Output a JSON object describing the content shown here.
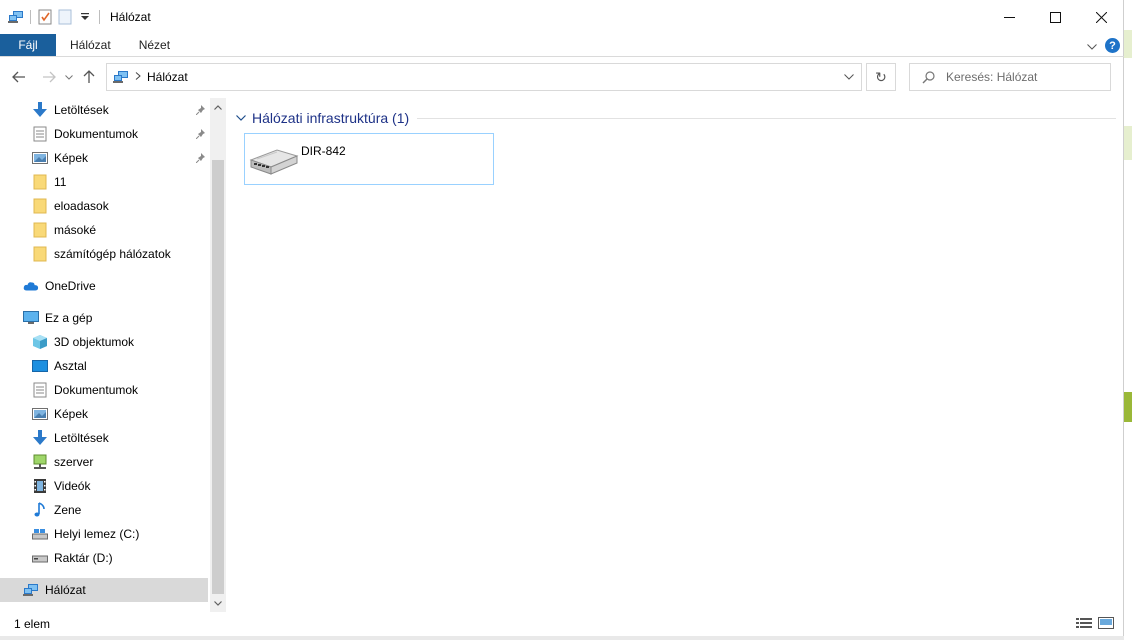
{
  "window": {
    "title": "Hálózat",
    "controls": {
      "minimize": "—",
      "maximize": "☐",
      "close": "✕"
    }
  },
  "ribbon": {
    "tabs": [
      {
        "label": "Fájl"
      },
      {
        "label": "Hálózat"
      },
      {
        "label": "Nézet"
      }
    ],
    "help": "?"
  },
  "navigation": {
    "breadcrumb": [
      "Hálózat"
    ],
    "refresh_glyph": "↻",
    "search": {
      "placeholder": "Keresés: Hálózat",
      "value": ""
    }
  },
  "sidebar": {
    "items": [
      {
        "label": "Letöltések",
        "icon": "download-icon",
        "pinned": true
      },
      {
        "label": "Dokumentumok",
        "icon": "documents-icon",
        "pinned": true
      },
      {
        "label": "Képek",
        "icon": "pictures-icon",
        "pinned": true
      },
      {
        "label": "11",
        "icon": "folder-icon",
        "pinned": false
      },
      {
        "label": "eloadasok",
        "icon": "folder-icon",
        "pinned": false
      },
      {
        "label": "másoké",
        "icon": "folder-icon",
        "pinned": false
      },
      {
        "label": "számítógép hálózatok",
        "icon": "folder-icon",
        "pinned": false
      },
      {
        "label": "OneDrive",
        "icon": "onedrive-cloud-icon",
        "pinned": false
      },
      {
        "label": "Ez a gép",
        "icon": "this-pc-icon",
        "pinned": false
      },
      {
        "label": "3D objektumok",
        "icon": "3d-objects-icon",
        "pinned": false
      },
      {
        "label": "Asztal",
        "icon": "desktop-icon",
        "pinned": false
      },
      {
        "label": "Dokumentumok",
        "icon": "documents-icon",
        "pinned": false
      },
      {
        "label": "Képek",
        "icon": "pictures-icon",
        "pinned": false
      },
      {
        "label": "Letöltések",
        "icon": "download-icon",
        "pinned": false
      },
      {
        "label": "szerver",
        "icon": "network-drive-icon",
        "pinned": false
      },
      {
        "label": "Videók",
        "icon": "videos-icon",
        "pinned": false
      },
      {
        "label": "Zene",
        "icon": "music-icon",
        "pinned": false
      },
      {
        "label": "Helyi lemez (C:)",
        "icon": "local-disk-icon",
        "pinned": false
      },
      {
        "label": "Raktár (D:)",
        "icon": "drive-icon",
        "pinned": false
      },
      {
        "label": "Hálózat",
        "icon": "network-icon",
        "pinned": false,
        "selected": true
      }
    ]
  },
  "content": {
    "group": {
      "title": "Hálózati infrastruktúra (1)"
    },
    "items": [
      {
        "name": "DIR-842",
        "icon": "router-icon"
      }
    ]
  },
  "statusbar": {
    "text": "1 elem"
  },
  "colors": {
    "file_tab": "#1a5f9c",
    "group_title": "#1e3287",
    "tile_border": "#99d1ff",
    "selected_bg": "#d9d9d9",
    "folder": "#f9d978",
    "accent_blue": "#1e73c8"
  }
}
